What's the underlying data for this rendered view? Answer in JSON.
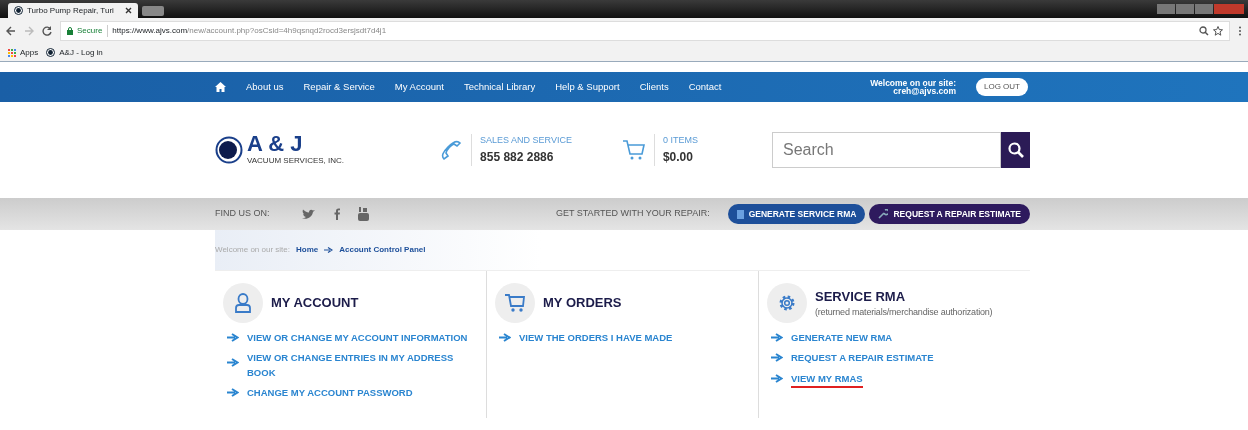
{
  "browser": {
    "tab_title": "Turbo Pump Repair, Turi",
    "secure_label": "Secure",
    "url_host": "https://www.ajvs.com",
    "url_path": "/new/account.php?osCsid=4h9qsnqd2rocd3ersjsdt7d4j1",
    "bookmarks": [
      {
        "label": "Apps",
        "kind": "apps"
      },
      {
        "label": "A&J - Log in",
        "kind": "site"
      }
    ]
  },
  "nav": {
    "items": [
      "About us",
      "Repair & Service",
      "My Account",
      "Technical Library",
      "Help & Support",
      "Clients",
      "Contact"
    ],
    "welcome": "Welcome on our site:",
    "email": "creh@ajvs.com",
    "logout": "LOG OUT"
  },
  "header": {
    "logo_text": "A & J",
    "logo_sub": "VACUUM SERVICES, INC.",
    "phone_label": "SALES AND SERVICE",
    "phone": "855 882 2886",
    "cart_label": "0 ITEMS",
    "cart_total": "$0.00",
    "search": {
      "placeholder": "Search"
    }
  },
  "social": {
    "label": "FIND US ON:",
    "cta_label": "GET STARTED WITH YOUR REPAIR:",
    "buttons": [
      {
        "label": "GENERATE SERVICE RMA",
        "kind": "primary"
      },
      {
        "label": "REQUEST A REPAIR ESTIMATE",
        "kind": "dark"
      }
    ]
  },
  "breadcrumb": {
    "intro": "Welcome on our site:",
    "items": [
      "Home",
      "Account Control Panel"
    ]
  },
  "panels": [
    {
      "title": "MY ACCOUNT",
      "kind": "user",
      "links": [
        {
          "label": "VIEW OR CHANGE MY ACCOUNT INFORMATION",
          "underlined": false
        },
        {
          "label": "VIEW OR CHANGE ENTRIES IN MY ADDRESS BOOK",
          "underlined": false
        },
        {
          "label": "CHANGE MY ACCOUNT PASSWORD",
          "underlined": false
        }
      ]
    },
    {
      "title": "MY ORDERS",
      "kind": "cart",
      "links": [
        {
          "label": "VIEW THE ORDERS I HAVE MADE",
          "underlined": false
        }
      ]
    },
    {
      "title": "SERVICE RMA",
      "subtitle": "(returned materials/merchandise authorization)",
      "kind": "gear",
      "links": [
        {
          "label": "GENERATE NEW RMA",
          "underlined": false
        },
        {
          "label": "REQUEST A REPAIR ESTIMATE",
          "underlined": false
        },
        {
          "label": "VIEW MY RMAS",
          "underlined": true
        }
      ]
    }
  ]
}
